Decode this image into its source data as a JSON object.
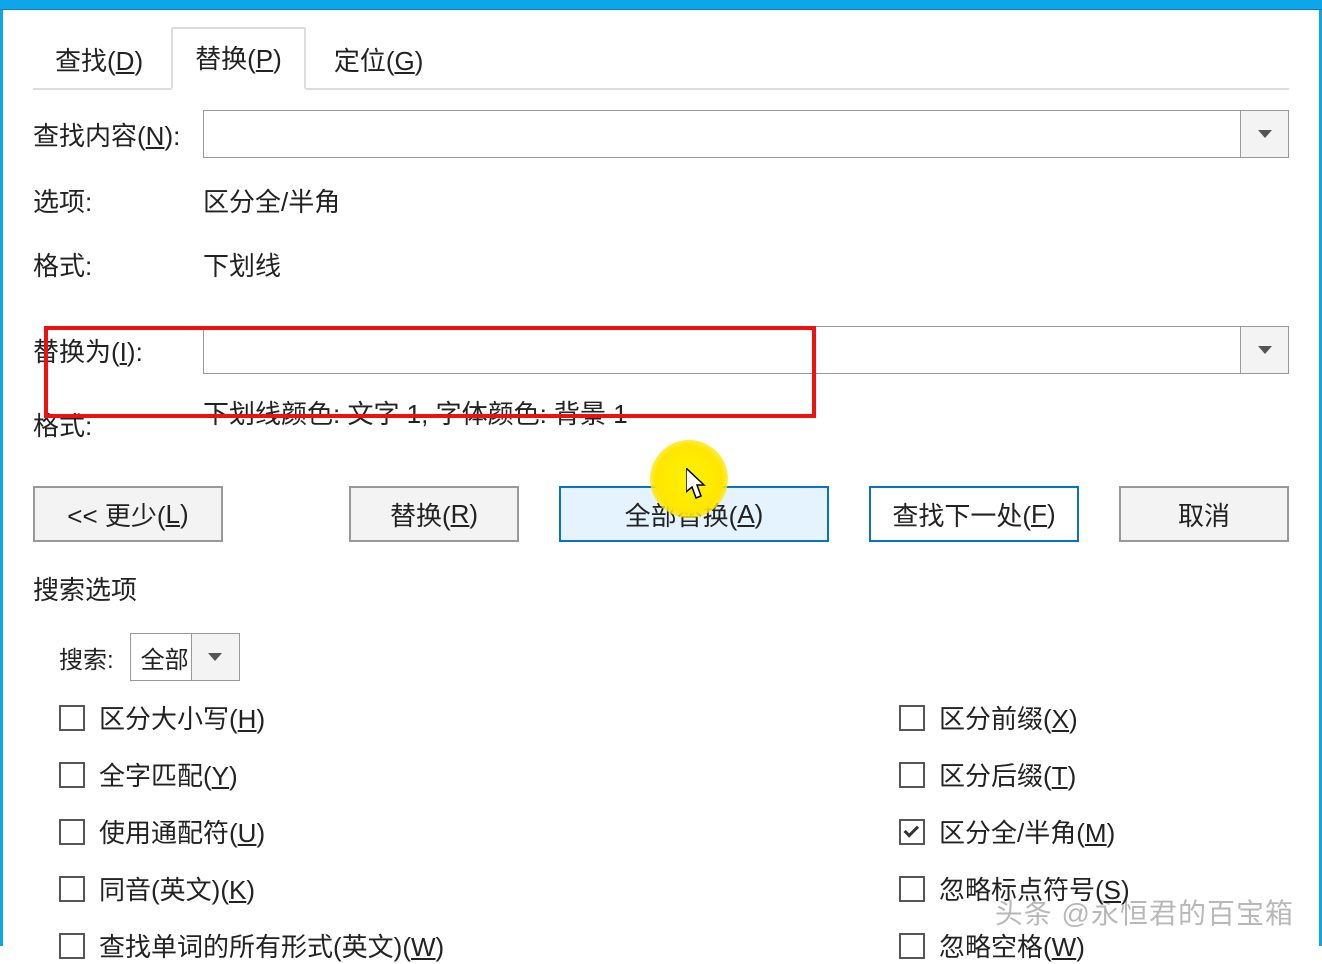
{
  "tabs": {
    "find": {
      "pre": "查找(",
      "u": "D",
      "post": ")"
    },
    "replace": {
      "pre": "替换(",
      "u": "P",
      "post": ")"
    },
    "goto": {
      "pre": "定位(",
      "u": "G",
      "post": ")"
    }
  },
  "find": {
    "label_pre": "查找内容(",
    "label_u": "N",
    "label_post": "):",
    "value": ""
  },
  "options_row": {
    "label": "选项:",
    "value": "区分全/半角"
  },
  "format_row": {
    "label": "格式:",
    "value": "下划线"
  },
  "replace_with": {
    "label_pre": "替换为(",
    "label_u": "I",
    "label_post": "):",
    "value": ""
  },
  "replace_format_row": {
    "label": "格式:",
    "value": "下划线颜色: 文字 1, 字体颜色: 背景 1"
  },
  "buttons": {
    "less": {
      "pre": "<< 更少(",
      "u": "L",
      "post": ")"
    },
    "replace": {
      "pre": "替换(",
      "u": "R",
      "post": ")"
    },
    "replace_all": {
      "pre": "全部替换(",
      "u": "A",
      "post": ")"
    },
    "find_next": {
      "pre": "查找下一处(",
      "u": "F",
      "post": ")"
    },
    "cancel": "取消"
  },
  "search_options": {
    "section": "搜索选项",
    "direction_label": "搜索:",
    "direction_value": "全部",
    "left": [
      {
        "checked": false,
        "pre": "区分大小写(",
        "u": "H",
        "post": ")"
      },
      {
        "checked": false,
        "pre": "全字匹配(",
        "u": "Y",
        "post": ")"
      },
      {
        "checked": false,
        "pre": "使用通配符(",
        "u": "U",
        "post": ")"
      },
      {
        "checked": false,
        "pre": "同音(英文)(",
        "u": "K",
        "post": ")"
      },
      {
        "checked": false,
        "pre": "查找单词的所有形式(英文)(",
        "u": "W",
        "post": ")"
      }
    ],
    "right": [
      {
        "checked": false,
        "pre": "区分前缀(",
        "u": "X",
        "post": ")"
      },
      {
        "checked": false,
        "pre": "区分后缀(",
        "u": "T",
        "post": ")"
      },
      {
        "checked": true,
        "pre": "区分全/半角(",
        "u": "M",
        "post": ")"
      },
      {
        "checked": false,
        "pre": "忽略标点符号(",
        "u": "S",
        "post": ")"
      },
      {
        "checked": false,
        "pre": "忽略空格(",
        "u": "W",
        "post": ")"
      }
    ]
  },
  "watermark": "头条 @永恒君的百宝箱"
}
